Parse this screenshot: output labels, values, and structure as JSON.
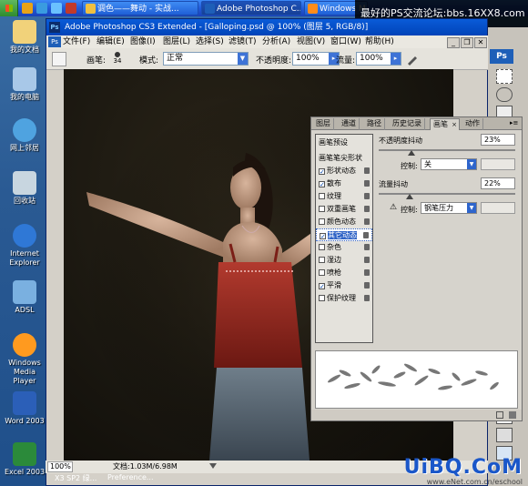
{
  "taskbar": {
    "tasks": [
      {
        "label": "调色——舞动 - 实战..."
      },
      {
        "label": "Adobe Photoshop C..."
      },
      {
        "label": "Windows M..."
      }
    ],
    "banner": "最好的PS交流论坛:bbs.16XX8.com"
  },
  "desktop": {
    "icons": [
      {
        "label": "我的文档"
      },
      {
        "label": "我的电脑"
      },
      {
        "label": "网上邻居"
      },
      {
        "label": "回收站"
      },
      {
        "label": "Internet Explorer"
      },
      {
        "label": "ADSL"
      },
      {
        "label": "Windows Media Player"
      },
      {
        "label": "Word 2003"
      },
      {
        "label": "Excel 2003"
      }
    ]
  },
  "photoshop": {
    "title": "Adobe Photoshop CS3 Extended - [Galloping.psd @ 100% (图层 5, RGB/8)]",
    "app_icon": "Ps",
    "menu": [
      "文件(F)",
      "编辑(E)",
      "图像(I)",
      "图层(L)",
      "选择(S)",
      "滤镜(T)",
      "分析(A)",
      "视图(V)",
      "窗口(W)",
      "帮助(H)"
    ],
    "options": {
      "brush_label": "画笔:",
      "brush_size": "34",
      "mode_label": "模式:",
      "mode_value": "正常",
      "opacity_label": "不透明度:",
      "opacity_value": "100%",
      "flow_label": "流量:",
      "flow_value": "100%"
    },
    "toolbox_label": "Ps",
    "status": {
      "zoom": "100%",
      "doc": "文档:1.03M/6.98M"
    }
  },
  "brush_panel": {
    "tabs": [
      "图层",
      "通道",
      "路径",
      "历史记录",
      "画笔",
      "动作"
    ],
    "active_tab": 4,
    "presets_label": "画笔预设",
    "tip_shape_label": "画笔笔尖形状",
    "items": [
      {
        "label": "形状动态",
        "checked": true
      },
      {
        "label": "散布",
        "checked": true
      },
      {
        "label": "纹理",
        "checked": false
      },
      {
        "label": "双重画笔",
        "checked": false
      },
      {
        "label": "颜色动态",
        "checked": false
      },
      {
        "label": "其它动态",
        "checked": true
      },
      {
        "label": "杂色",
        "checked": false
      },
      {
        "label": "湿边",
        "checked": false
      },
      {
        "label": "喷枪",
        "checked": false
      },
      {
        "label": "平滑",
        "checked": true
      },
      {
        "label": "保护纹理",
        "checked": false
      }
    ],
    "selected_index": 5,
    "opacity_jitter_label": "不透明度抖动",
    "opacity_jitter_value": "23%",
    "control_label": "控制:",
    "control1_value": "关",
    "flow_jitter_label": "流量抖动",
    "flow_jitter_value": "22%",
    "control2_value": "钢笔压力"
  },
  "taskbar_bottom": {
    "items": [
      "X3 SP2 绿...",
      "Preference..."
    ]
  },
  "watermark": {
    "main": "UiBQ.CoM",
    "sub": "www.eNet.com.cn/eschool"
  }
}
